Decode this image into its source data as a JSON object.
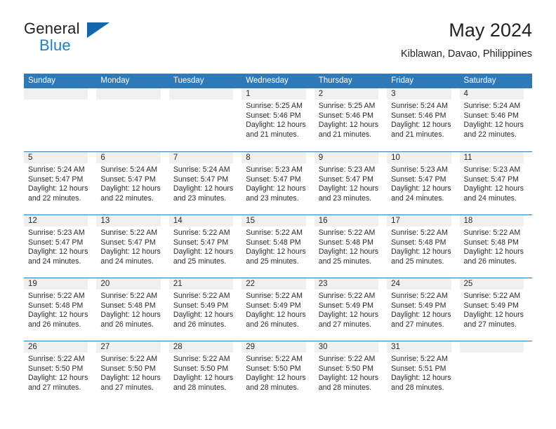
{
  "brand": {
    "name_part1": "General",
    "name_part2": "Blue",
    "logo_icon": "triangle-flag-icon"
  },
  "header": {
    "title": "May 2024",
    "subtitle": "Kiblawan, Davao, Philippines"
  },
  "colors": {
    "header_blue": "#2e7ab8",
    "brand_blue": "#1f7fc4",
    "logo_blue": "#1565a8",
    "daynum_band": "#f0f0f0",
    "text": "#2b2b2b"
  },
  "weekdays": [
    "Sunday",
    "Monday",
    "Tuesday",
    "Wednesday",
    "Thursday",
    "Friday",
    "Saturday"
  ],
  "labels": {
    "sunrise_prefix": "Sunrise:",
    "sunset_prefix": "Sunset:",
    "daylight_prefix": "Daylight:"
  },
  "weeks": [
    [
      {
        "day": "",
        "lines": []
      },
      {
        "day": "",
        "lines": []
      },
      {
        "day": "",
        "lines": []
      },
      {
        "day": "1",
        "lines": [
          "Sunrise: 5:25 AM",
          "Sunset: 5:46 PM",
          "Daylight: 12 hours",
          "and 21 minutes."
        ]
      },
      {
        "day": "2",
        "lines": [
          "Sunrise: 5:25 AM",
          "Sunset: 5:46 PM",
          "Daylight: 12 hours",
          "and 21 minutes."
        ]
      },
      {
        "day": "3",
        "lines": [
          "Sunrise: 5:24 AM",
          "Sunset: 5:46 PM",
          "Daylight: 12 hours",
          "and 21 minutes."
        ]
      },
      {
        "day": "4",
        "lines": [
          "Sunrise: 5:24 AM",
          "Sunset: 5:46 PM",
          "Daylight: 12 hours",
          "and 22 minutes."
        ]
      }
    ],
    [
      {
        "day": "5",
        "lines": [
          "Sunrise: 5:24 AM",
          "Sunset: 5:47 PM",
          "Daylight: 12 hours",
          "and 22 minutes."
        ]
      },
      {
        "day": "6",
        "lines": [
          "Sunrise: 5:24 AM",
          "Sunset: 5:47 PM",
          "Daylight: 12 hours",
          "and 22 minutes."
        ]
      },
      {
        "day": "7",
        "lines": [
          "Sunrise: 5:24 AM",
          "Sunset: 5:47 PM",
          "Daylight: 12 hours",
          "and 23 minutes."
        ]
      },
      {
        "day": "8",
        "lines": [
          "Sunrise: 5:23 AM",
          "Sunset: 5:47 PM",
          "Daylight: 12 hours",
          "and 23 minutes."
        ]
      },
      {
        "day": "9",
        "lines": [
          "Sunrise: 5:23 AM",
          "Sunset: 5:47 PM",
          "Daylight: 12 hours",
          "and 23 minutes."
        ]
      },
      {
        "day": "10",
        "lines": [
          "Sunrise: 5:23 AM",
          "Sunset: 5:47 PM",
          "Daylight: 12 hours",
          "and 24 minutes."
        ]
      },
      {
        "day": "11",
        "lines": [
          "Sunrise: 5:23 AM",
          "Sunset: 5:47 PM",
          "Daylight: 12 hours",
          "and 24 minutes."
        ]
      }
    ],
    [
      {
        "day": "12",
        "lines": [
          "Sunrise: 5:23 AM",
          "Sunset: 5:47 PM",
          "Daylight: 12 hours",
          "and 24 minutes."
        ]
      },
      {
        "day": "13",
        "lines": [
          "Sunrise: 5:22 AM",
          "Sunset: 5:47 PM",
          "Daylight: 12 hours",
          "and 24 minutes."
        ]
      },
      {
        "day": "14",
        "lines": [
          "Sunrise: 5:22 AM",
          "Sunset: 5:47 PM",
          "Daylight: 12 hours",
          "and 25 minutes."
        ]
      },
      {
        "day": "15",
        "lines": [
          "Sunrise: 5:22 AM",
          "Sunset: 5:48 PM",
          "Daylight: 12 hours",
          "and 25 minutes."
        ]
      },
      {
        "day": "16",
        "lines": [
          "Sunrise: 5:22 AM",
          "Sunset: 5:48 PM",
          "Daylight: 12 hours",
          "and 25 minutes."
        ]
      },
      {
        "day": "17",
        "lines": [
          "Sunrise: 5:22 AM",
          "Sunset: 5:48 PM",
          "Daylight: 12 hours",
          "and 25 minutes."
        ]
      },
      {
        "day": "18",
        "lines": [
          "Sunrise: 5:22 AM",
          "Sunset: 5:48 PM",
          "Daylight: 12 hours",
          "and 26 minutes."
        ]
      }
    ],
    [
      {
        "day": "19",
        "lines": [
          "Sunrise: 5:22 AM",
          "Sunset: 5:48 PM",
          "Daylight: 12 hours",
          "and 26 minutes."
        ]
      },
      {
        "day": "20",
        "lines": [
          "Sunrise: 5:22 AM",
          "Sunset: 5:48 PM",
          "Daylight: 12 hours",
          "and 26 minutes."
        ]
      },
      {
        "day": "21",
        "lines": [
          "Sunrise: 5:22 AM",
          "Sunset: 5:49 PM",
          "Daylight: 12 hours",
          "and 26 minutes."
        ]
      },
      {
        "day": "22",
        "lines": [
          "Sunrise: 5:22 AM",
          "Sunset: 5:49 PM",
          "Daylight: 12 hours",
          "and 26 minutes."
        ]
      },
      {
        "day": "23",
        "lines": [
          "Sunrise: 5:22 AM",
          "Sunset: 5:49 PM",
          "Daylight: 12 hours",
          "and 27 minutes."
        ]
      },
      {
        "day": "24",
        "lines": [
          "Sunrise: 5:22 AM",
          "Sunset: 5:49 PM",
          "Daylight: 12 hours",
          "and 27 minutes."
        ]
      },
      {
        "day": "25",
        "lines": [
          "Sunrise: 5:22 AM",
          "Sunset: 5:49 PM",
          "Daylight: 12 hours",
          "and 27 minutes."
        ]
      }
    ],
    [
      {
        "day": "26",
        "lines": [
          "Sunrise: 5:22 AM",
          "Sunset: 5:50 PM",
          "Daylight: 12 hours",
          "and 27 minutes."
        ]
      },
      {
        "day": "27",
        "lines": [
          "Sunrise: 5:22 AM",
          "Sunset: 5:50 PM",
          "Daylight: 12 hours",
          "and 27 minutes."
        ]
      },
      {
        "day": "28",
        "lines": [
          "Sunrise: 5:22 AM",
          "Sunset: 5:50 PM",
          "Daylight: 12 hours",
          "and 28 minutes."
        ]
      },
      {
        "day": "29",
        "lines": [
          "Sunrise: 5:22 AM",
          "Sunset: 5:50 PM",
          "Daylight: 12 hours",
          "and 28 minutes."
        ]
      },
      {
        "day": "30",
        "lines": [
          "Sunrise: 5:22 AM",
          "Sunset: 5:50 PM",
          "Daylight: 12 hours",
          "and 28 minutes."
        ]
      },
      {
        "day": "31",
        "lines": [
          "Sunrise: 5:22 AM",
          "Sunset: 5:51 PM",
          "Daylight: 12 hours",
          "and 28 minutes."
        ]
      },
      {
        "day": "",
        "lines": []
      }
    ]
  ]
}
